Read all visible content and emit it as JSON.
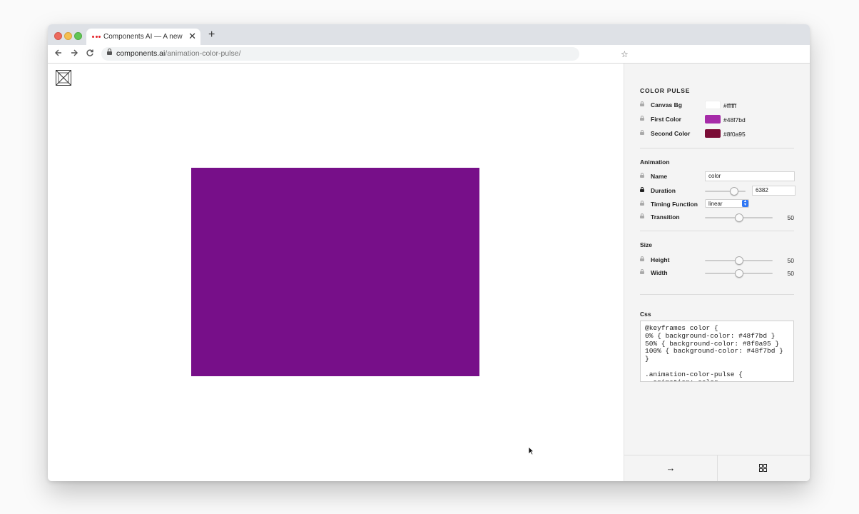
{
  "browser": {
    "tab_title": "Components AI — A new way to",
    "tab_close": "✕",
    "new_tab": "+",
    "url_host": "components.ai",
    "url_path": "/animation-color-pulse/",
    "back_icon": "arrow-left-icon",
    "forward_icon": "arrow-right-icon",
    "reload_icon": "reload-icon",
    "bookmark_icon": "star-icon"
  },
  "canvas": {
    "box_color": "#770f89"
  },
  "sidebar": {
    "color_section": {
      "title": "COLOR PULSE",
      "rows": [
        {
          "label": "Canvas Bg",
          "value": "#ffffff",
          "swatch": "#ffffff"
        },
        {
          "label": "First Color",
          "value": "#48f7bd",
          "swatch": "#a62ba8"
        },
        {
          "label": "Second Color",
          "value": "#8f0a95",
          "swatch": "#7a0c36"
        }
      ]
    },
    "animation_section": {
      "title": "Animation",
      "name_label": "Name",
      "name_value": "color",
      "duration_label": "Duration",
      "duration_value": "6382",
      "duration_slider": 0.72,
      "timing_label": "Timing Function",
      "timing_value": "linear",
      "transition_label": "Transition",
      "transition_value": "50",
      "transition_slider": 0.5
    },
    "size_section": {
      "title": "Size",
      "height_label": "Height",
      "height_value": "50",
      "height_slider": 0.5,
      "width_label": "Width",
      "width_value": "50",
      "width_slider": 0.5
    },
    "css_section": {
      "title": "Css",
      "code": "@keyframes color {\n0% { background-color: #48f7bd }\n50% { background-color: #8f0a95 }\n100% { background-color: #48f7bd }\n}\n\n.animation-color-pulse {\n  animation: color"
    },
    "footer": {
      "next_icon": "arrow-right-icon",
      "next_glyph": "→",
      "grid_icon": "grid-icon"
    }
  }
}
